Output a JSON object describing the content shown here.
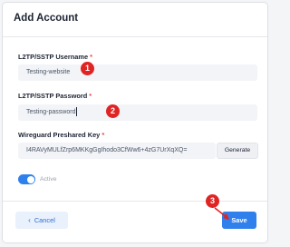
{
  "dialog": {
    "title": "Add Account"
  },
  "fields": {
    "username": {
      "label": "L2TP/SSTP Username",
      "required": "*",
      "value": "Testing-website"
    },
    "password": {
      "label": "L2TP/SSTP Password",
      "required": "*",
      "value": "Testing-password"
    },
    "preshared_key": {
      "label": "Wireguard Preshared Key",
      "required": "*",
      "value": "I4RAVyMULfZrp6MKKgGgIhodo3CfWw6+4zG7UrXqXQ=",
      "generate_label": "Generate"
    }
  },
  "toggle": {
    "label": "Active",
    "state": "on"
  },
  "footer": {
    "cancel_label": "Cancel",
    "save_label": "Save"
  },
  "annotations": {
    "marker_1": "1",
    "marker_2": "2",
    "marker_3": "3",
    "marker_color": "#e02424"
  },
  "colors": {
    "accent": "#2f80ed",
    "required": "#e5484d"
  },
  "icons": {
    "cancel": "chevron-left-icon"
  }
}
